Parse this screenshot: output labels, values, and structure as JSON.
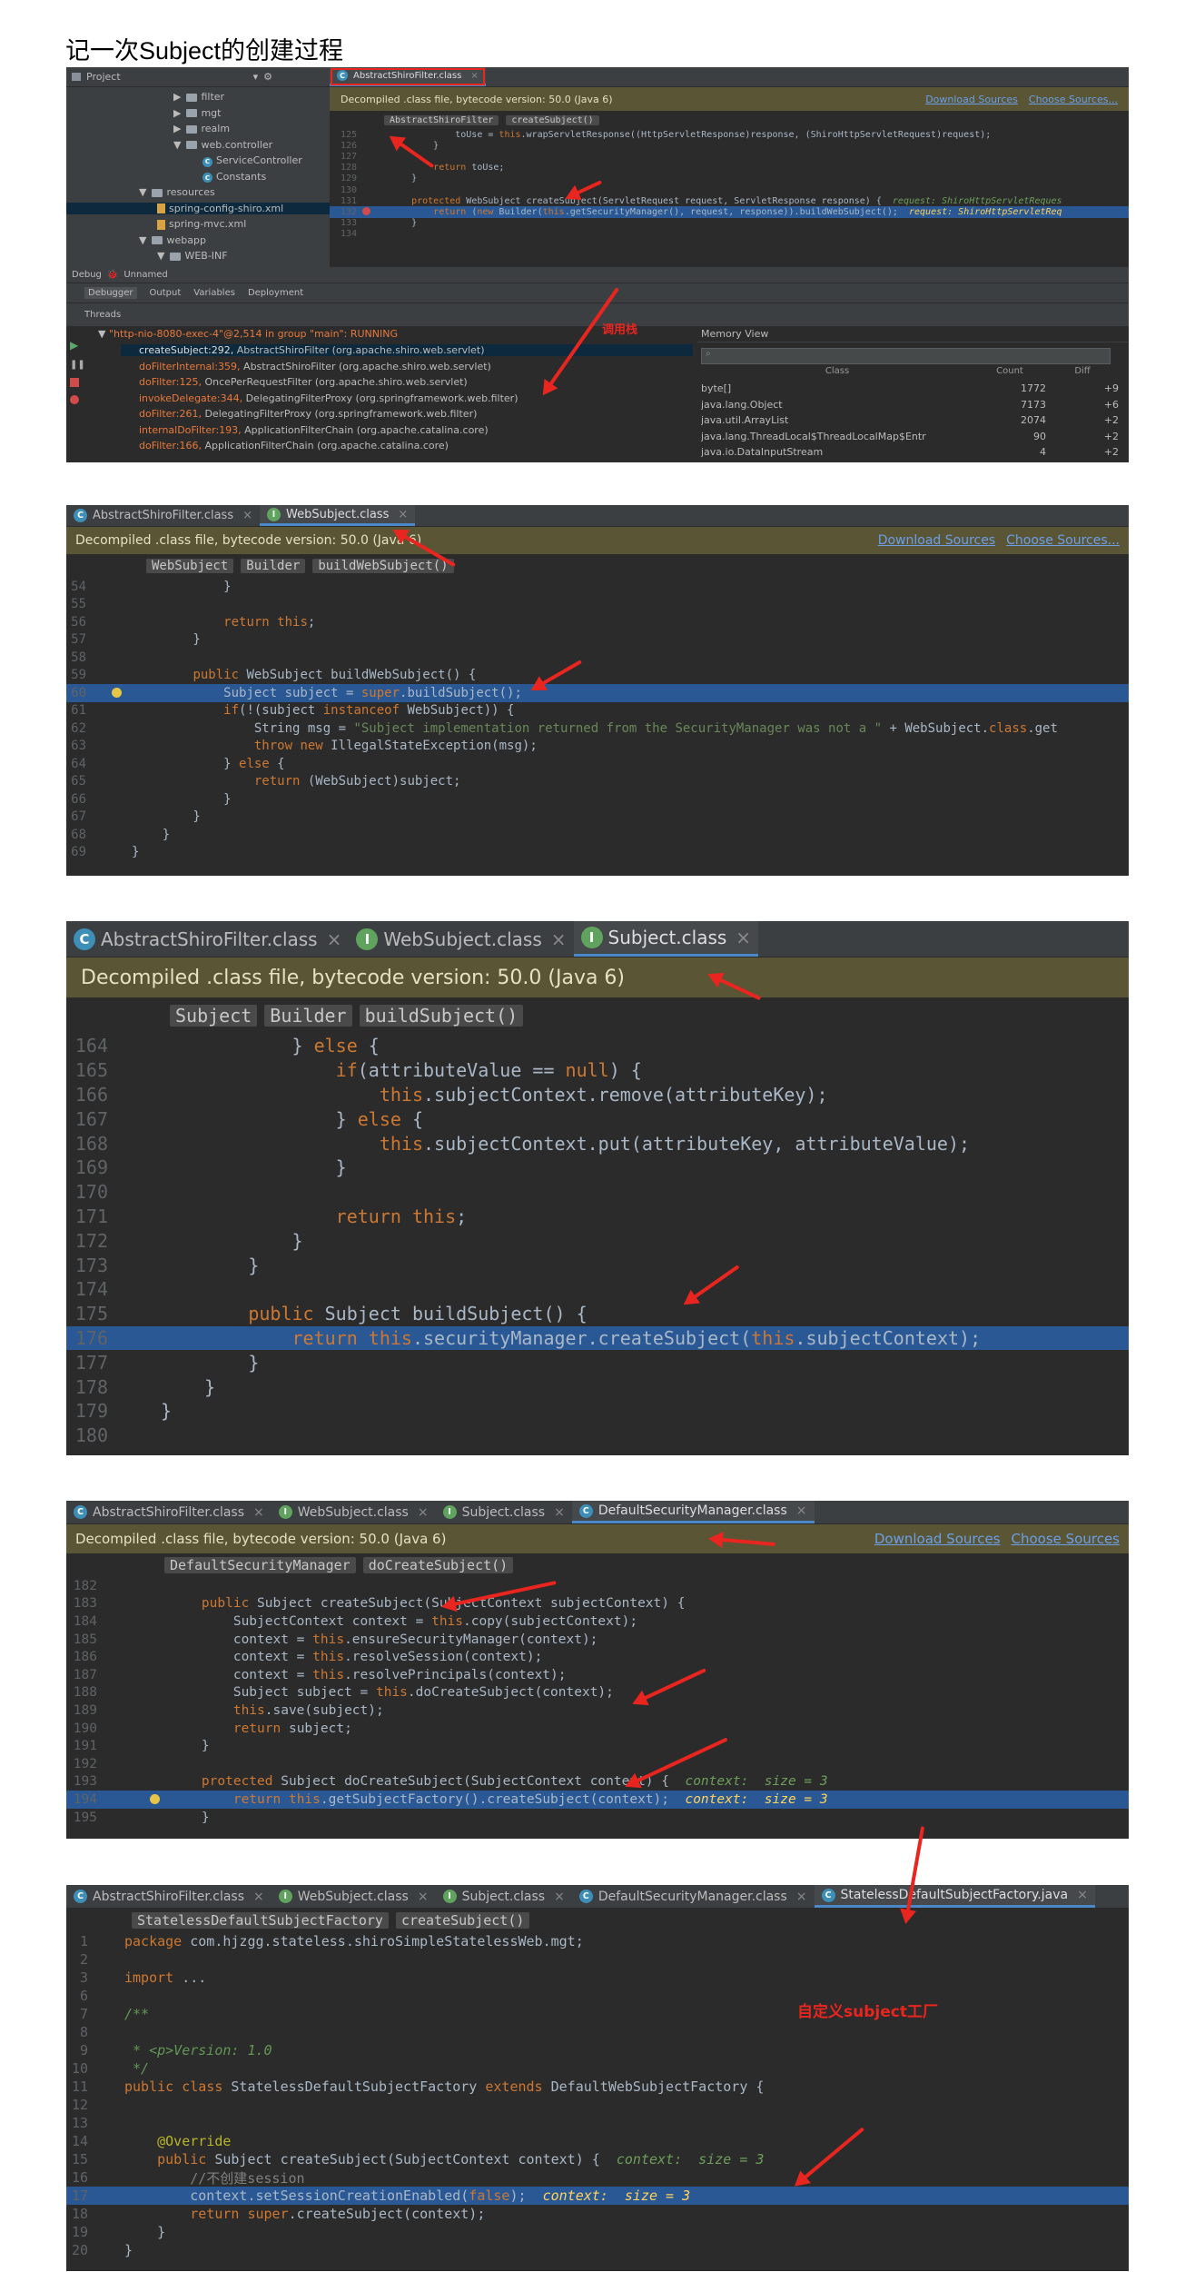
{
  "page_title": "记一次Subject的创建过程",
  "shot1": {
    "project_label": "Project",
    "tree": [
      {
        "label": "filter",
        "type": "folder"
      },
      {
        "label": "mgt",
        "type": "folder"
      },
      {
        "label": "realm",
        "type": "folder"
      },
      {
        "label": "web.controller",
        "type": "folder"
      },
      {
        "label": "ServiceController",
        "type": "class"
      },
      {
        "label": "Constants",
        "type": "class"
      },
      {
        "label": "resources",
        "type": "folder"
      },
      {
        "label": "spring-config-shiro.xml",
        "type": "file"
      },
      {
        "label": "spring-mvc.xml",
        "type": "file"
      },
      {
        "label": "webapp",
        "type": "folder"
      },
      {
        "label": "WEB-INF",
        "type": "folder"
      }
    ],
    "tab": "AbstractShiroFilter.class",
    "banner": "Decompiled .class file, bytecode version: 50.0 (Java 6)",
    "download_sources": "Download Sources",
    "choose_sources": "Choose Sources...",
    "crumbs": [
      "AbstractShiroFilter",
      "createSubject()"
    ],
    "code": [
      {
        "n": "125",
        "t": "            toUse = this.wrapServletResponse((HttpServletResponse)response, (ShiroHttpServletRequest)request);"
      },
      {
        "n": "126",
        "t": "        }"
      },
      {
        "n": "127",
        "t": ""
      },
      {
        "n": "128",
        "t": "        return toUse;"
      },
      {
        "n": "129",
        "t": "    }"
      },
      {
        "n": "130",
        "t": ""
      },
      {
        "n": "131",
        "t": "    protected WebSubject createSubject(ServletRequest request, ServletResponse response) {",
        "dbg": "  request: ShiroHttpServletReques"
      },
      {
        "n": "132",
        "t": "        return (new Builder(this.getSecurityManager(), request, response)).buildWebSubject();",
        "dbg": "  request: ShiroHttpServletReq",
        "hl": true
      },
      {
        "n": "133",
        "t": "    }"
      },
      {
        "n": "134",
        "t": ""
      }
    ],
    "debug_label": "Debug",
    "debug_config": "Unnamed",
    "debug_tabs": [
      "Debugger",
      "Output",
      "Variables",
      "Deployment"
    ],
    "threads_label": "Threads",
    "thread_name": "\"http-nio-8080-exec-4\"@2,514 in group \"main\": RUNNING",
    "frames": [
      {
        "m": "createSubject:292,",
        "r": " AbstractShiroFilter (org.apache.shiro.web.servlet)",
        "sel": true
      },
      {
        "m": "doFilterInternal:359,",
        "r": " AbstractShiroFilter (org.apache.shiro.web.servlet)"
      },
      {
        "m": "doFilter:125,",
        "r": " OncePerRequestFilter (org.apache.shiro.web.servlet)"
      },
      {
        "m": "invokeDelegate:344,",
        "r": " DelegatingFilterProxy (org.springframework.web.filter)"
      },
      {
        "m": "doFilter:261,",
        "r": " DelegatingFilterProxy (org.springframework.web.filter)"
      },
      {
        "m": "internalDoFilter:193,",
        "r": " ApplicationFilterChain (org.apache.catalina.core)"
      },
      {
        "m": "doFilter:166,",
        "r": " ApplicationFilterChain (org.apache.catalina.core)"
      }
    ],
    "call_stack_note": "调用栈",
    "memory_label": "Memory View",
    "memory_headers": [
      "Class",
      "Count",
      "Diff"
    ],
    "memory_rows": [
      {
        "cls": "byte[]",
        "count": "1772",
        "diff": "+9"
      },
      {
        "cls": "java.lang.Object",
        "count": "7173",
        "diff": "+6"
      },
      {
        "cls": "java.util.ArrayList",
        "count": "2074",
        "diff": "+2"
      },
      {
        "cls": "java.lang.ThreadLocal$ThreadLocalMap$Entr",
        "count": "90",
        "diff": "+2"
      },
      {
        "cls": "java.io.DataInputStream",
        "count": "4",
        "diff": "+2"
      }
    ]
  },
  "shot2": {
    "tabs": [
      {
        "label": "AbstractShiroFilter.class",
        "icon": "C"
      },
      {
        "label": "WebSubject.class",
        "icon": "I",
        "active": true
      }
    ],
    "banner": "Decompiled .class file, bytecode version: 50.0 (Java 6)",
    "download_sources": "Download Sources",
    "choose_sources": "Choose Sources...",
    "crumbs": [
      "WebSubject",
      "Builder",
      "buildWebSubject()"
    ],
    "code": [
      {
        "n": "54",
        "t": "            }"
      },
      {
        "n": "55",
        "t": ""
      },
      {
        "n": "56",
        "t": "            return this;"
      },
      {
        "n": "57",
        "t": "        }"
      },
      {
        "n": "58",
        "t": ""
      },
      {
        "n": "59",
        "t": "        public WebSubject buildWebSubject() {"
      },
      {
        "n": "60",
        "t": "            Subject subject = super.buildSubject();",
        "hl": true
      },
      {
        "n": "61",
        "t": "            if(!(subject instanceof WebSubject)) {"
      },
      {
        "n": "62",
        "t": "                String msg = \"Subject implementation returned from the SecurityManager was not a \" + WebSubject.class.get"
      },
      {
        "n": "63",
        "t": "                throw new IllegalStateException(msg);"
      },
      {
        "n": "64",
        "t": "            } else {"
      },
      {
        "n": "65",
        "t": "                return (WebSubject)subject;"
      },
      {
        "n": "66",
        "t": "            }"
      },
      {
        "n": "67",
        "t": "        }"
      },
      {
        "n": "68",
        "t": "    }"
      },
      {
        "n": "69",
        "t": "}"
      }
    ]
  },
  "shot3": {
    "tabs": [
      {
        "label": "AbstractShiroFilter.class",
        "icon": "C"
      },
      {
        "label": "WebSubject.class",
        "icon": "I"
      },
      {
        "label": "Subject.class",
        "icon": "I",
        "active": true
      }
    ],
    "banner": "Decompiled .class file, bytecode version: 50.0 (Java 6)",
    "crumbs": [
      "Subject",
      "Builder",
      "buildSubject()"
    ],
    "code": [
      {
        "n": "164",
        "t": "            } else {"
      },
      {
        "n": "165",
        "t": "                if(attributeValue == null) {"
      },
      {
        "n": "166",
        "t": "                    this.subjectContext.remove(attributeKey);"
      },
      {
        "n": "167",
        "t": "                } else {"
      },
      {
        "n": "168",
        "t": "                    this.subjectContext.put(attributeKey, attributeValue);"
      },
      {
        "n": "169",
        "t": "                }"
      },
      {
        "n": "170",
        "t": ""
      },
      {
        "n": "171",
        "t": "                return this;"
      },
      {
        "n": "172",
        "t": "            }"
      },
      {
        "n": "173",
        "t": "        }"
      },
      {
        "n": "174",
        "t": ""
      },
      {
        "n": "175",
        "t": "        public Subject buildSubject() {"
      },
      {
        "n": "176",
        "t": "            return this.securityManager.createSubject(this.subjectContext);",
        "hl": true
      },
      {
        "n": "177",
        "t": "        }"
      },
      {
        "n": "178",
        "t": "    }"
      },
      {
        "n": "179",
        "t": "}"
      },
      {
        "n": "180",
        "t": ""
      }
    ]
  },
  "shot4": {
    "tabs": [
      {
        "label": "AbstractShiroFilter.class",
        "icon": "C"
      },
      {
        "label": "WebSubject.class",
        "icon": "I"
      },
      {
        "label": "Subject.class",
        "icon": "I"
      },
      {
        "label": "DefaultSecurityManager.class",
        "icon": "C",
        "active": true
      }
    ],
    "banner": "Decompiled .class file, bytecode version: 50.0 (Java 6)",
    "download_sources": "Download Sources",
    "choose_sources": "Choose Sources",
    "crumbs": [
      "DefaultSecurityManager",
      "doCreateSubject()"
    ],
    "code": [
      {
        "n": "182",
        "t": ""
      },
      {
        "n": "183",
        "t": "    public Subject createSubject(SubjectContext subjectContext) {"
      },
      {
        "n": "184",
        "t": "        SubjectContext context = this.copy(subjectContext);"
      },
      {
        "n": "185",
        "t": "        context = this.ensureSecurityManager(context);"
      },
      {
        "n": "186",
        "t": "        context = this.resolveSession(context);"
      },
      {
        "n": "187",
        "t": "        context = this.resolvePrincipals(context);"
      },
      {
        "n": "188",
        "t": "        Subject subject = this.doCreateSubject(context);"
      },
      {
        "n": "189",
        "t": "        this.save(subject);"
      },
      {
        "n": "190",
        "t": "        return subject;"
      },
      {
        "n": "191",
        "t": "    }"
      },
      {
        "n": "192",
        "t": ""
      },
      {
        "n": "193",
        "t": "    protected Subject doCreateSubject(SubjectContext context) {",
        "dbg": "  context:  size = 3"
      },
      {
        "n": "194",
        "t": "        return this.getSubjectFactory().createSubject(context);",
        "dbg": "  context:  size = 3",
        "hl": true
      },
      {
        "n": "195",
        "t": "    }"
      }
    ]
  },
  "shot5": {
    "tabs": [
      {
        "label": "AbstractShiroFilter.class",
        "icon": "C"
      },
      {
        "label": "WebSubject.class",
        "icon": "I"
      },
      {
        "label": "Subject.class",
        "icon": "I"
      },
      {
        "label": "DefaultSecurityManager.class",
        "icon": "C"
      },
      {
        "label": "StatelessDefaultSubjectFactory.java",
        "icon": "C",
        "active": true
      }
    ],
    "crumbs": [
      "StatelessDefaultSubjectFactory",
      "createSubject()"
    ],
    "code": [
      {
        "n": "1",
        "t": "package com.hjzgg.stateless.shiroSimpleStatelessWeb.mgt;"
      },
      {
        "n": "2",
        "t": ""
      },
      {
        "n": "3",
        "t": "import ..."
      },
      {
        "n": "6",
        "t": ""
      },
      {
        "n": "7",
        "t": "/**"
      },
      {
        "n": "8",
        "t": ""
      },
      {
        "n": "9",
        "t": " * <p>Version: 1.0"
      },
      {
        "n": "10",
        "t": " */"
      },
      {
        "n": "11",
        "t": "public class StatelessDefaultSubjectFactory extends DefaultWebSubjectFactory {"
      },
      {
        "n": "12",
        "t": ""
      },
      {
        "n": "13",
        "t": ""
      },
      {
        "n": "14",
        "t": "    @Override"
      },
      {
        "n": "15",
        "t": "    public Subject createSubject(SubjectContext context) {",
        "dbg": "  context:  size = 3"
      },
      {
        "n": "16",
        "t": "        //不创建session"
      },
      {
        "n": "17",
        "t": "        context.setSessionCreationEnabled(false);",
        "dbg": "  context:  size = 3",
        "hl": true
      },
      {
        "n": "18",
        "t": "        return super.createSubject(context);"
      },
      {
        "n": "19",
        "t": "    }"
      },
      {
        "n": "20",
        "t": "}"
      }
    ],
    "note": "自定义subject工厂"
  },
  "colors": {
    "accent_red": "#e8251f",
    "highlight": "#2a5894",
    "keyword": "#cc7832",
    "string": "#6a8759"
  }
}
